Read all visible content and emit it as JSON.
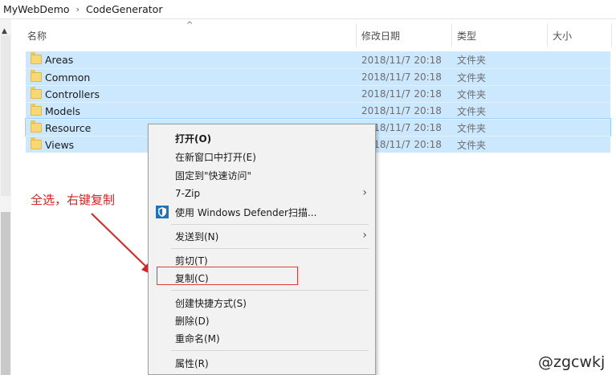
{
  "breadcrumb": {
    "items": [
      "MyWebDemo",
      "CodeGenerator"
    ]
  },
  "columns": {
    "name": "名称",
    "modified": "修改日期",
    "type": "类型",
    "size": "大小"
  },
  "rows": [
    {
      "name": "Areas",
      "modified": "2018/11/7 20:18",
      "type": "文件夹"
    },
    {
      "name": "Common",
      "modified": "2018/11/7 20:18",
      "type": "文件夹"
    },
    {
      "name": "Controllers",
      "modified": "2018/11/7 20:18",
      "type": "文件夹"
    },
    {
      "name": "Models",
      "modified": "2018/11/7 20:18",
      "type": "文件夹"
    },
    {
      "name": "Resource",
      "modified": "2018/11/7 20:18",
      "type": "文件夹"
    },
    {
      "name": "Views",
      "modified": "2018/11/7 20:18",
      "type": "文件夹"
    }
  ],
  "context_menu": {
    "items": [
      {
        "label": "打开(O)"
      },
      {
        "label": "在新窗口中打开(E)"
      },
      {
        "label": "固定到\"快速访问\""
      },
      {
        "label": "7-Zip"
      },
      {
        "label": "使用 Windows Defender扫描..."
      },
      {
        "label": "发送到(N)"
      },
      {
        "label": "剪切(T)"
      },
      {
        "label": "复制(C)"
      },
      {
        "label": "创建快捷方式(S)"
      },
      {
        "label": "删除(D)"
      },
      {
        "label": "重命名(M)"
      },
      {
        "label": "属性(R)"
      }
    ]
  },
  "annotation": {
    "text": "全选，右键复制",
    "color": "#e02020"
  },
  "watermark": "@zgcwkj",
  "colors": {
    "selection": "#cce8ff",
    "menu_bg": "#f2f2f2",
    "highlight_box": "#e23b3b"
  }
}
